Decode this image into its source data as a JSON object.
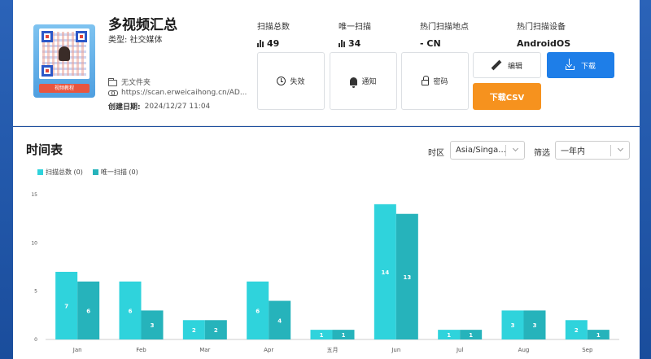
{
  "qr": {
    "title": "多视频汇总",
    "type_label": "类型: 社交媒体",
    "ribbon_text": "视频教程",
    "folder": "无文件夹",
    "url": "https://scan.erweicaihong.cn/AD...",
    "created_label": "创建日期:",
    "created_value": "2024/12/27 11:04"
  },
  "stats": {
    "total_label": "扫描总数",
    "total_value": "49",
    "unique_label": "唯一扫描",
    "unique_value": "34",
    "location_label": "热门扫描地点",
    "location_value": "- CN",
    "device_label": "热门扫描设备",
    "device_value": "AndroidOS"
  },
  "actions": {
    "expire": "失效",
    "notify": "通知",
    "password": "密码",
    "edit": "编辑",
    "download": "下载",
    "download_csv": "下载CSV"
  },
  "timeline": {
    "title": "时间表",
    "timezone_label": "时区",
    "timezone_value": "Asia/Singa...",
    "filter_label": "筛选",
    "filter_value": "一年内"
  },
  "colors": {
    "total": "#2fd3dc",
    "unique": "#26b3bb",
    "download": "#1e7ee8",
    "csv": "#f6921e"
  },
  "chart_data": {
    "type": "bar",
    "categories": [
      "Jan",
      "Feb",
      "Mar",
      "Apr",
      "五月",
      "Jun",
      "Jul",
      "Aug",
      "Sep"
    ],
    "series": [
      {
        "name": "扫描总数 (0)",
        "values": [
          7,
          6,
          2,
          6,
          1,
          14,
          1,
          3,
          2
        ]
      },
      {
        "name": "唯一扫描 (0)",
        "values": [
          6,
          3,
          2,
          4,
          1,
          13,
          1,
          3,
          1
        ]
      }
    ],
    "ylim": [
      0,
      15
    ],
    "yticks": [
      0,
      5,
      10,
      15
    ],
    "legend": "top-left",
    "grid": false
  }
}
